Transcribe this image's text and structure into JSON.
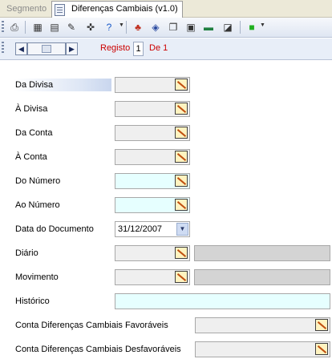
{
  "tabs": {
    "inactive": "Segmento",
    "active": "Diferenças Cambiais (v1.0)"
  },
  "nav": {
    "record_label": "Registo",
    "page": "1",
    "of_label": "De 1"
  },
  "fields": {
    "da_divisa": "Da Divisa",
    "a_divisa": "À Divisa",
    "da_conta": "Da Conta",
    "a_conta": "À Conta",
    "do_numero": "Do Número",
    "ao_numero": "Ao Número",
    "data_documento": "Data do Documento",
    "data_documento_value": "31/12/2007",
    "diario": "Diário",
    "movimento": "Movimento",
    "historico": "Histórico",
    "conta_favoraveis": "Conta Diferenças Cambiais Favoráveis",
    "conta_desfavoraveis": "Conta Diferenças Cambiais Desfavoráveis"
  }
}
